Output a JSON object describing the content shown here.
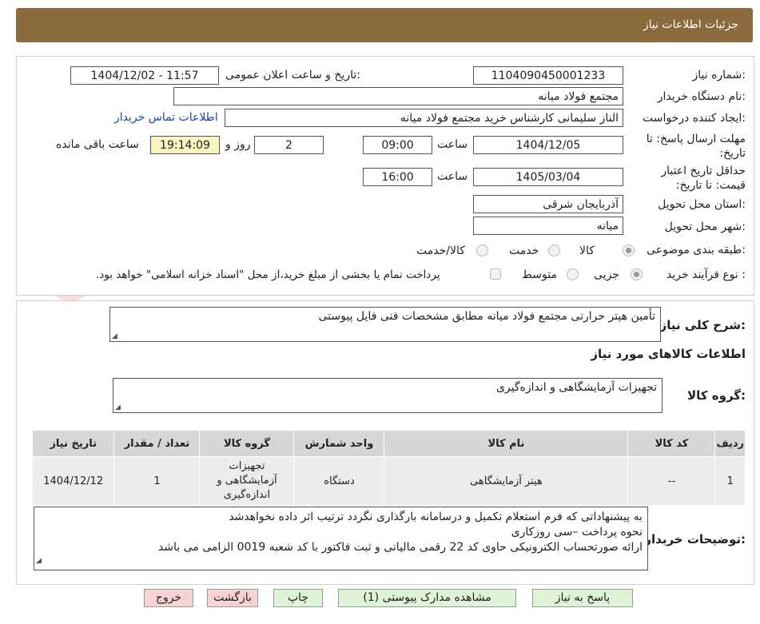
{
  "header": {
    "title": "جزئیات اطلاعات نیاز"
  },
  "watermark": {
    "text": "AriaTender.neT"
  },
  "form": {
    "need_number_label": "شماره نیاز:",
    "need_number": "1104090450001233",
    "announce_label": "تاریخ و ساعت اعلان عمومی:",
    "announce_value": "1404/12/02 - 11:57",
    "buyer_org_label": "نام دستگاه خریدار:",
    "buyer_org": "مجتمع فولاد میانه",
    "requester_label": "ایجاد کننده درخواست:",
    "requester": "الناز سلیمانی کارشناس خرید مجتمع فولاد میانه",
    "contact_link": "اطلاعات تماس خریدار",
    "deadline_label": "مهلت ارسال پاسخ: تا تاریخ:",
    "deadline_date": "1404/12/05",
    "time_label": "ساعت",
    "deadline_time": "09:00",
    "days_value": "2",
    "days_label": "روز و",
    "remaining_time": "19:14:09",
    "remaining_label": "ساعت باقی مانده",
    "price_validity_label": "حداقل تاریخ اعتبار قیمت: تا تاریخ:",
    "price_validity_date": "1405/03/04",
    "price_validity_time": "16:00",
    "province_label": "استان محل تحویل:",
    "province": "آذربایجان شرقی",
    "city_label": "شهر محل تحویل:",
    "city": "میانه",
    "category_label": "طبقه بندی موضوعی:",
    "category_options": [
      "کالا",
      "خدمت",
      "کالا/خدمت"
    ],
    "category_selected": "کالا",
    "process_label": "نوع فرآیند خرید :",
    "process_options": [
      "جزیی",
      "متوسط"
    ],
    "process_selected": "جزیی",
    "process_note": "پرداخت تمام یا بخشی از مبلغ خرید،از محل \"اسناد خزانه اسلامی\" خواهد بود."
  },
  "summary": {
    "label": "شرح کلی نیاز:",
    "text": "تأمین هیتر حرارتی مجتمع فولاد میانه مطابق مشخصات فنی فایل پیوستی",
    "goods_info_title": "اطلاعات کالاهای مورد نیاز",
    "group_label": "گروه کالا:",
    "group_value": "تجهیزات آزمایشگاهی و اندازه‌گیری"
  },
  "table": {
    "headers": [
      "ردیف",
      "کد کالا",
      "نام کالا",
      "واحد شمارش",
      "گروه کالا",
      "تعداد / مقدار",
      "تاریخ نیاز"
    ],
    "rows": [
      [
        "1",
        "--",
        "هیتر آزمایشگاهی",
        "دستگاه",
        "تجهیزات آزمایشگاهی و اندازه‌گیری",
        "1",
        "1404/12/12"
      ]
    ]
  },
  "notes": {
    "label": "توضیحات خریدار:",
    "lines": [
      "به پیشنهاداتی که فرم استعلام تکمیل و درسامانه بارگذاری نگردد ترتیب اثر داده نخواهدشد",
      "نحوه پرداخت –سی روزکاری",
      "ارائه صورتحساب الکترونیکی حاوی کد 22 رقمی مالیاتی و ثبت فاکتور با کد شعبه 0019 الزامی می باشد"
    ]
  },
  "buttons": {
    "reply": "پاسخ به نیاز",
    "attachments": "مشاهده مدارک پیوستی (1)",
    "print": "چاپ",
    "back": "بازگشت",
    "exit": "خروج"
  }
}
